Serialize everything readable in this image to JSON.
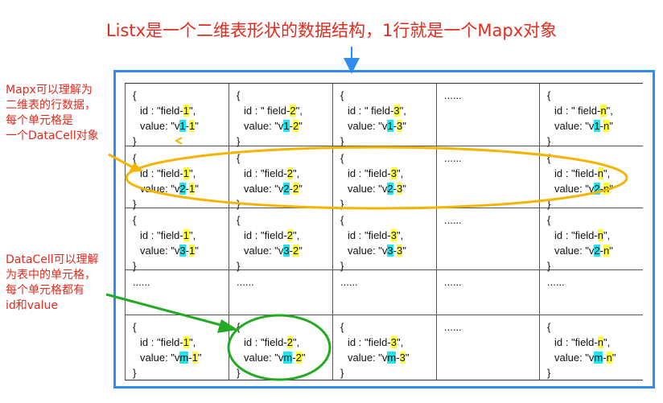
{
  "title": "Listx是一个二维表形状的数据结构，1行就是一个Mapx对象",
  "annotations": {
    "mapx": [
      "Mapx可以理解为",
      "二维表的行数据，",
      "每个单元格是",
      "一个DataCell对象"
    ],
    "datacell": [
      "DataCell可以理解",
      "为表中的单元格，",
      "每个单元格都有",
      "id和value"
    ]
  },
  "labels": {
    "open": "{",
    "close": "}",
    "id_key": "id : ",
    "value_key": "value: ",
    "ellipsis": "......"
  },
  "rows": [
    [
      {
        "idq": "\"",
        "f": "field-",
        "fn": "1",
        "v": "v",
        "r": "1",
        "d": "-",
        "c": "1"
      },
      {
        "idq": "\" ",
        "f": "field-",
        "fn": "2",
        "v": "v",
        "r": "1",
        "d": "-",
        "c": "2"
      },
      {
        "idq": "\" ",
        "f": "field-",
        "fn": "3",
        "v": "v",
        "r": "1",
        "d": "-",
        "c": "3"
      },
      null,
      {
        "idq": "\" ",
        "f": "field-",
        "fn": "n",
        "v": "v",
        "r": "1",
        "d": "-",
        "c": "n"
      }
    ],
    [
      {
        "idq": "\"",
        "f": "field-",
        "fn": "1",
        "v": "v",
        "r": "2",
        "d": "-",
        "c": "1"
      },
      {
        "idq": "\"",
        "f": "field-",
        "fn": "2",
        "v": "v",
        "r": "2",
        "d": "-",
        "c": "2"
      },
      {
        "idq": "\"",
        "f": "field-",
        "fn": "3",
        "v": "v",
        "r": "2",
        "d": "-",
        "c": "3"
      },
      null,
      {
        "idq": "\"",
        "f": "field-",
        "fn": "n",
        "v": "v",
        "r": "2",
        "d": "-",
        "c": "n"
      }
    ],
    [
      {
        "idq": "\"",
        "f": "field-",
        "fn": "1",
        "v": "v",
        "r": "3",
        "d": "-",
        "c": "1"
      },
      {
        "idq": "\"",
        "f": "field-",
        "fn": "2",
        "v": "v",
        "r": "3",
        "d": "-",
        "c": "2"
      },
      {
        "idq": "\"",
        "f": "field-",
        "fn": "3",
        "v": "v",
        "r": "3",
        "d": "-",
        "c": "3"
      },
      null,
      {
        "idq": "\"",
        "f": "field-",
        "fn": "n",
        "v": "v",
        "r": "2",
        "d": "-",
        "c": "n"
      }
    ],
    "ellipsis",
    [
      {
        "idq": "\"",
        "f": "field-",
        "fn": "1",
        "v": "v",
        "r": "m",
        "d": "-",
        "c": "1"
      },
      {
        "idq": "\"",
        "f": "field-",
        "fn": "2",
        "v": "v",
        "r": "m",
        "d": "-",
        "c": "2"
      },
      {
        "idq": "\"",
        "f": "field-",
        "fn": "3",
        "v": "v",
        "r": "m",
        "d": "-",
        "c": "3"
      },
      null,
      {
        "idq": "\"",
        "f": "field-",
        "fn": "n",
        "v": "v",
        "r": "m",
        "d": "-",
        "c": "n"
      }
    ]
  ],
  "colors": {
    "title": "#e52a1e",
    "frame": "#2f8cf0",
    "row_ellipse": "#f5b400",
    "cell_ellipse": "#22aa22",
    "highlight_field": "#ffff33",
    "highlight_index": "#1ee6ee"
  }
}
